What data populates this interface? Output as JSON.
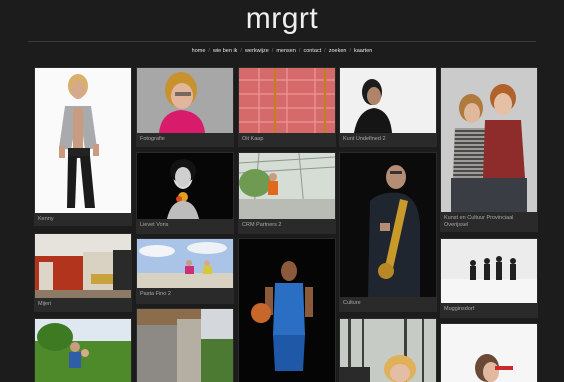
{
  "site": {
    "title": "mrgrt"
  },
  "nav": {
    "items": [
      "home",
      "wie ben ik",
      "werkwijze",
      "mensen",
      "contact",
      "zoeken",
      "kaarten"
    ],
    "separator": "/"
  },
  "gallery": {
    "captions": {
      "kenny": "Kenny",
      "fotografie": "Fotografie",
      "oudkaap": "Oit Kaap",
      "kunst": "Kunt Undefined 2",
      "kunstcultuur": "Kunst en Cultuur Provinciaal Overijssel",
      "lievekess": "Lievet Vons",
      "crmpartners": "CRM Partners 2",
      "culture": "Culture",
      "mijeri": "Mijeri",
      "paardenhe": "Pasta Fino 2",
      "mugginsdorf": "Mugginsdorf"
    }
  }
}
